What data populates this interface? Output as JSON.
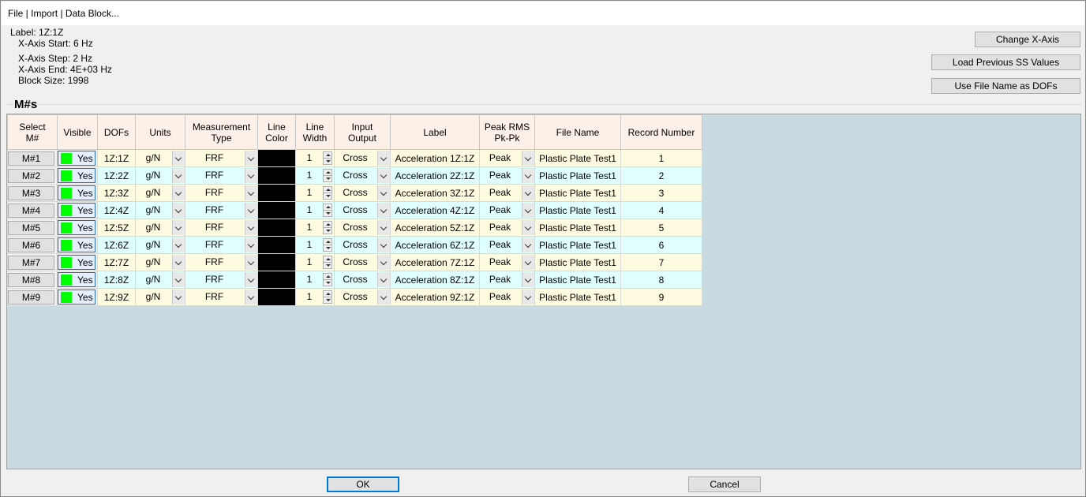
{
  "window": {
    "title": "File | Import | Data Block..."
  },
  "info": {
    "label": "Label: 1Z:1Z",
    "x_start": "X-Axis Start: 6 Hz",
    "x_step": "X-Axis Step: 2 Hz",
    "x_end": "X-Axis End: 4E+03 Hz",
    "block_size": "Block Size: 1998"
  },
  "buttons": {
    "change_x_axis": "Change X-Axis",
    "load_previous": "Load Previous SS Values",
    "use_file_name": "Use File Name as DOFs",
    "ok": "OK",
    "cancel": "Cancel"
  },
  "group": {
    "title": "M#s"
  },
  "columns": {
    "select": [
      "Select",
      "M#"
    ],
    "visible": "Visible",
    "dofs": "DOFs",
    "units": "Units",
    "mtype": [
      "Measurement",
      "Type"
    ],
    "lcolor": [
      "Line",
      "Color"
    ],
    "lwidth": [
      "Line",
      "Width"
    ],
    "io": [
      "Input",
      "Output"
    ],
    "label": "Label",
    "peak": [
      "Peak RMS",
      "Pk-Pk"
    ],
    "file": "File Name",
    "record": "Record Number"
  },
  "rows": [
    {
      "m": "M#1",
      "visible": "Yes",
      "dofs": "1Z:1Z",
      "units": "g/N",
      "mtype": "FRF",
      "color": "#000000",
      "width": "1",
      "io": "Cross",
      "label": "Acceleration 1Z:1Z",
      "peak": "Peak",
      "file": "Plastic Plate Test1",
      "record": "1"
    },
    {
      "m": "M#2",
      "visible": "Yes",
      "dofs": "1Z:2Z",
      "units": "g/N",
      "mtype": "FRF",
      "color": "#000000",
      "width": "1",
      "io": "Cross",
      "label": "Acceleration 2Z:1Z",
      "peak": "Peak",
      "file": "Plastic Plate Test1",
      "record": "2"
    },
    {
      "m": "M#3",
      "visible": "Yes",
      "dofs": "1Z:3Z",
      "units": "g/N",
      "mtype": "FRF",
      "color": "#000000",
      "width": "1",
      "io": "Cross",
      "label": "Acceleration 3Z:1Z",
      "peak": "Peak",
      "file": "Plastic Plate Test1",
      "record": "3"
    },
    {
      "m": "M#4",
      "visible": "Yes",
      "dofs": "1Z:4Z",
      "units": "g/N",
      "mtype": "FRF",
      "color": "#000000",
      "width": "1",
      "io": "Cross",
      "label": "Acceleration 4Z:1Z",
      "peak": "Peak",
      "file": "Plastic Plate Test1",
      "record": "4"
    },
    {
      "m": "M#5",
      "visible": "Yes",
      "dofs": "1Z:5Z",
      "units": "g/N",
      "mtype": "FRF",
      "color": "#000000",
      "width": "1",
      "io": "Cross",
      "label": "Acceleration 5Z:1Z",
      "peak": "Peak",
      "file": "Plastic Plate Test1",
      "record": "5"
    },
    {
      "m": "M#6",
      "visible": "Yes",
      "dofs": "1Z:6Z",
      "units": "g/N",
      "mtype": "FRF",
      "color": "#000000",
      "width": "1",
      "io": "Cross",
      "label": "Acceleration 6Z:1Z",
      "peak": "Peak",
      "file": "Plastic Plate Test1",
      "record": "6"
    },
    {
      "m": "M#7",
      "visible": "Yes",
      "dofs": "1Z:7Z",
      "units": "g/N",
      "mtype": "FRF",
      "color": "#000000",
      "width": "1",
      "io": "Cross",
      "label": "Acceleration 7Z:1Z",
      "peak": "Peak",
      "file": "Plastic Plate Test1",
      "record": "7"
    },
    {
      "m": "M#8",
      "visible": "Yes",
      "dofs": "1Z:8Z",
      "units": "g/N",
      "mtype": "FRF",
      "color": "#000000",
      "width": "1",
      "io": "Cross",
      "label": "Acceleration 8Z:1Z",
      "peak": "Peak",
      "file": "Plastic Plate Test1",
      "record": "8"
    },
    {
      "m": "M#9",
      "visible": "Yes",
      "dofs": "1Z:9Z",
      "units": "g/N",
      "mtype": "FRF",
      "color": "#000000",
      "width": "1",
      "io": "Cross",
      "label": "Acceleration 9Z:1Z",
      "peak": "Peak",
      "file": "Plastic Plate Test1",
      "record": "9"
    }
  ],
  "colors": {
    "visible_swatch": "#00ff00",
    "row_odd": "#fffbe0",
    "row_even": "#e0ffff",
    "header_bg": "#fdf0e8",
    "grid_bg": "#c9dae3"
  }
}
